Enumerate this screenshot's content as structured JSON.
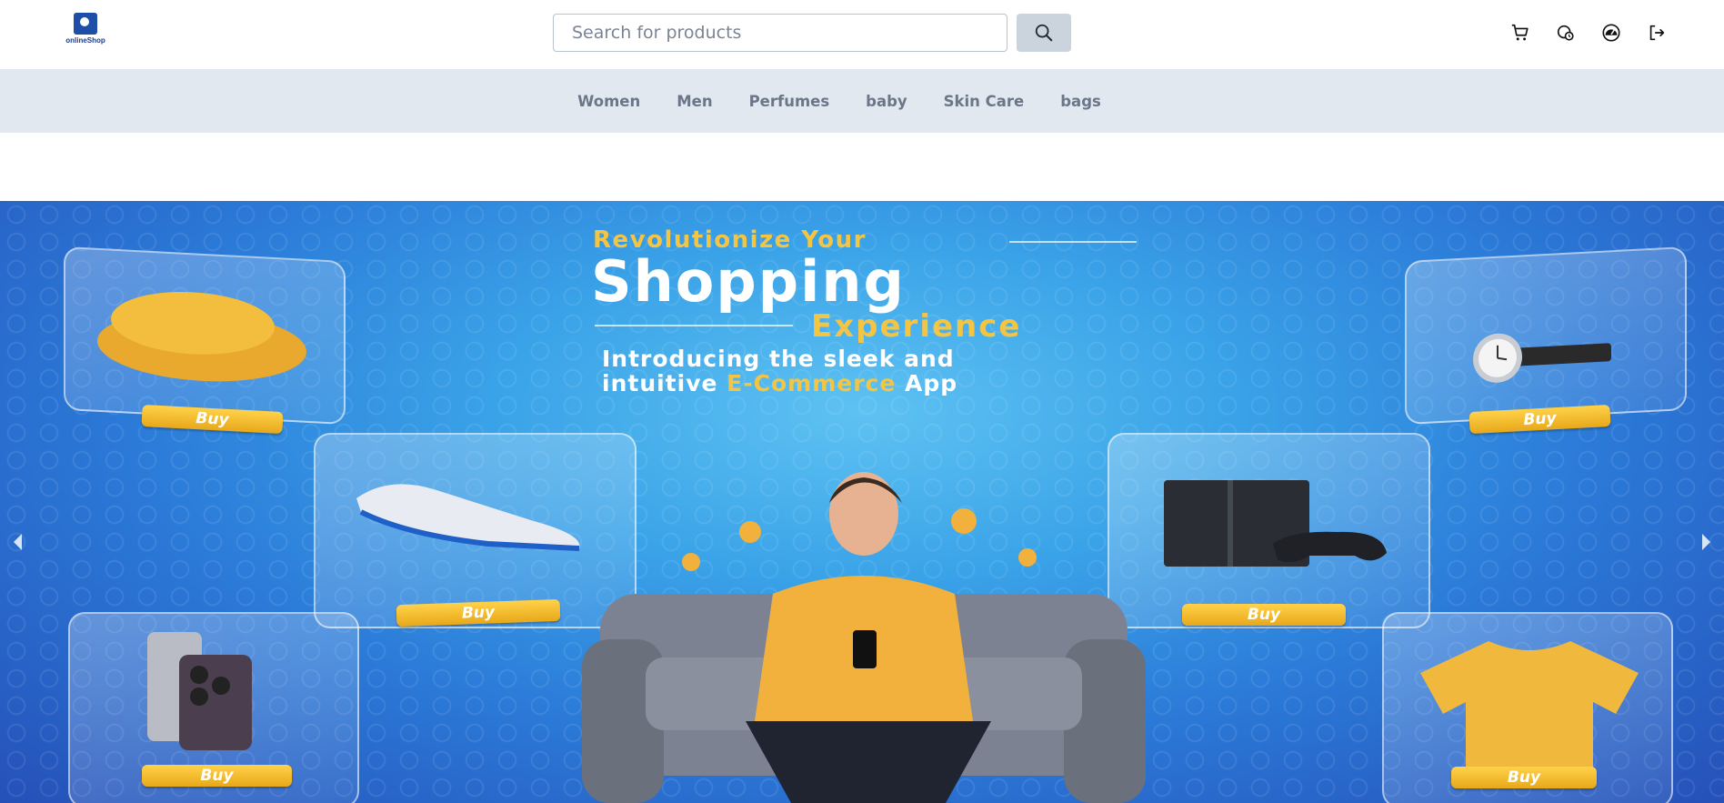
{
  "header": {
    "logo_text": "onlineShop",
    "logo_sub": "",
    "search": {
      "placeholder": "Search for products",
      "value": ""
    },
    "icons": [
      "search-icon",
      "cart-icon",
      "orders-icon",
      "dashboard-icon",
      "logout-icon"
    ]
  },
  "nav": {
    "items": [
      "Women",
      "Men",
      "Perfumes",
      "baby",
      "Skin Care",
      "bags"
    ]
  },
  "hero": {
    "title_line1": "Revolutionize Your",
    "title_line2": "Shopping",
    "title_line3": "Experience",
    "subtitle_part1": "Introducing the sleek and",
    "subtitle_part2": "intuitive ",
    "subtitle_highlight": "E-Commerce",
    "subtitle_part3": " App",
    "buy_label": "Buy",
    "colors": {
      "accent_yellow": "#f4c542",
      "background_blue": "#2b7ad8"
    }
  }
}
